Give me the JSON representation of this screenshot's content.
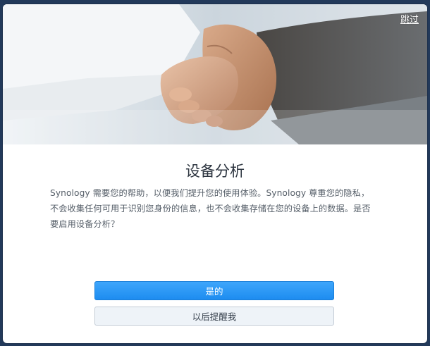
{
  "dialog": {
    "skip_label": "跳过",
    "title": "设备分析",
    "description": "Synology 需要您的帮助，以便我们提升您的使用体验。Synology 尊重您的隐私，不会收集任何可用于识别您身份的信息，也不会收集存储在您的设备上的数据。是否要启用设备分析？",
    "primary_button": "是的",
    "secondary_button": "以后提醒我"
  },
  "colors": {
    "primary": "#1d8cf0",
    "backdrop": "#22395a",
    "title": "#2d3540",
    "body_text": "#555e68"
  },
  "hero_image": "handshake-photo"
}
